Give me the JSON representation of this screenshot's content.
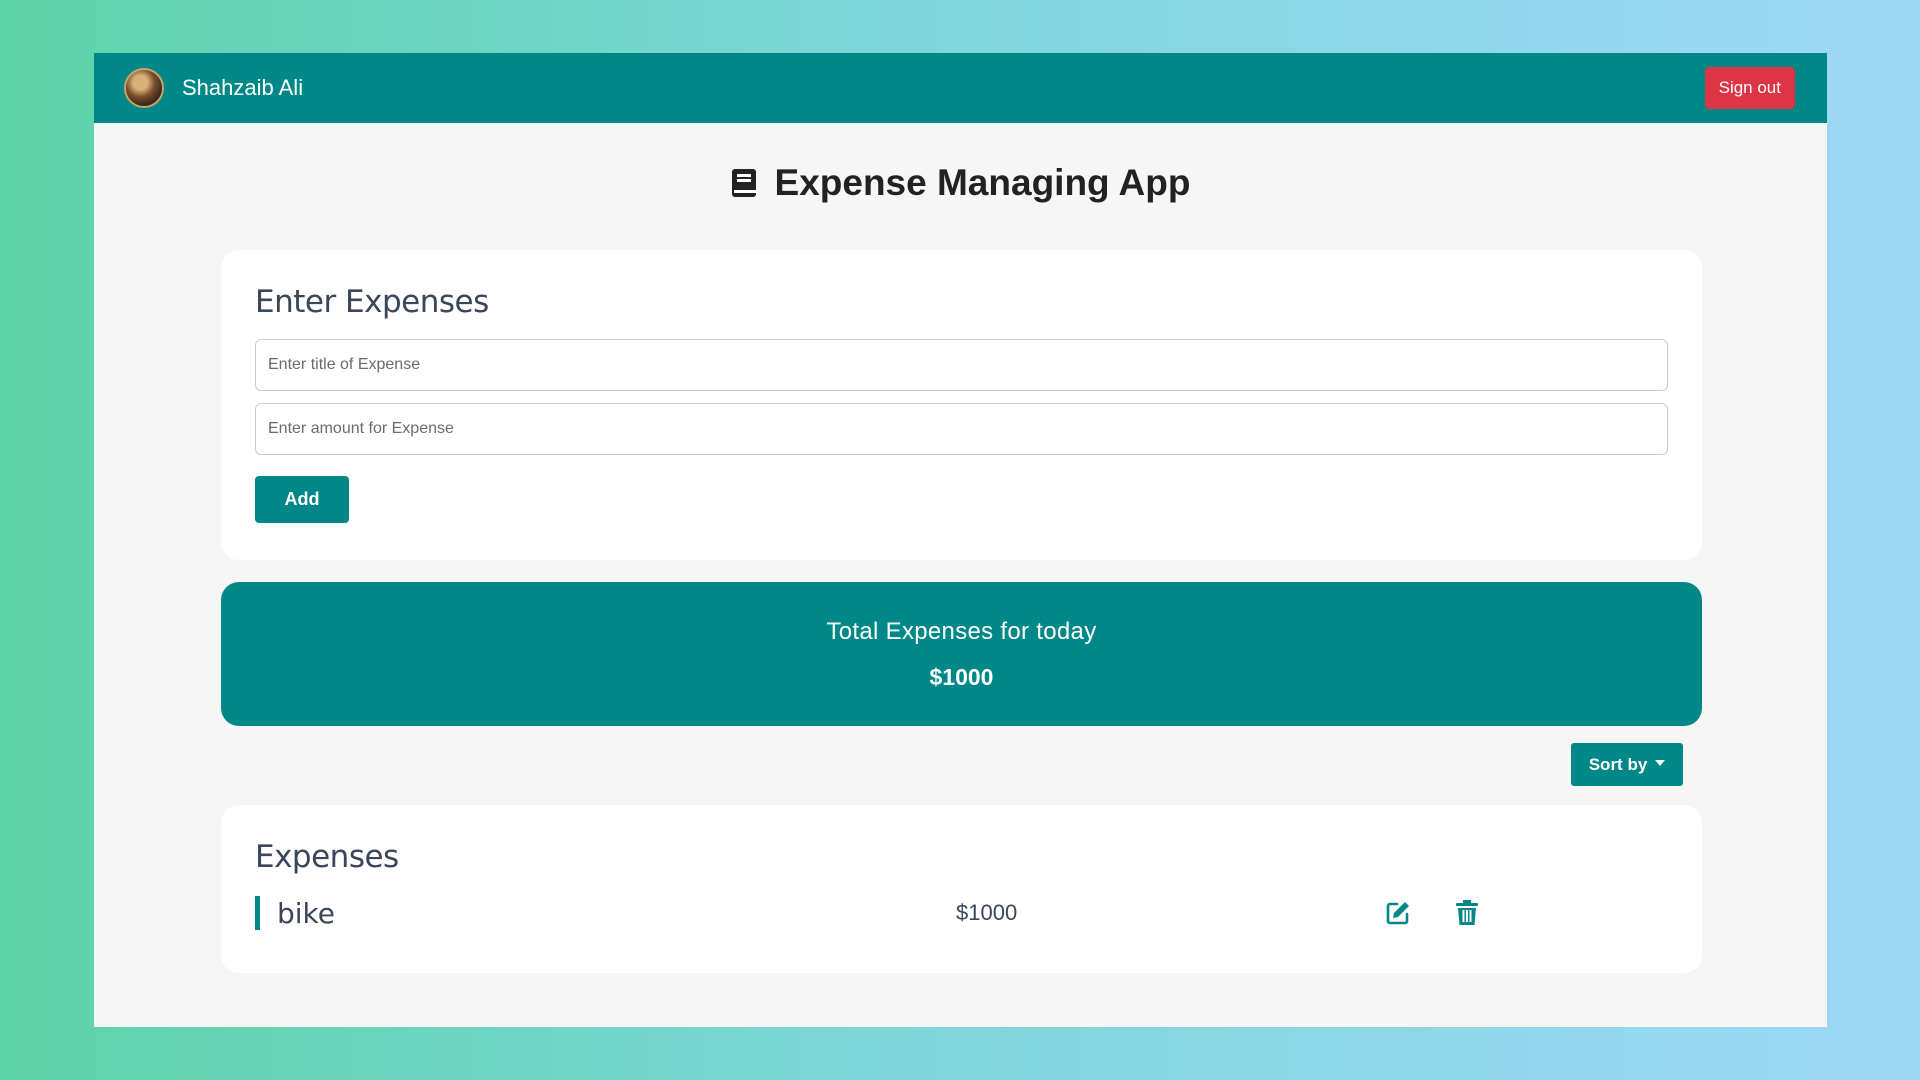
{
  "navbar": {
    "user_name": "Shahzaib Ali",
    "signout_label": "Sign out"
  },
  "header": {
    "title": "Expense Managing App",
    "icon": "book-icon"
  },
  "enter_expenses": {
    "heading": "Enter Expenses",
    "title_placeholder": "Enter title of Expense",
    "amount_placeholder": "Enter amount for Expense",
    "title_value": "",
    "amount_value": "",
    "add_label": "Add"
  },
  "total": {
    "label": "Total Expenses for today",
    "value": "$1000"
  },
  "sort": {
    "label": "Sort by"
  },
  "expenses": {
    "heading": "Expenses",
    "items": [
      {
        "title": "bike",
        "amount": "$1000",
        "edit_icon": "edit-icon",
        "delete_icon": "trash-icon"
      }
    ]
  },
  "colors": {
    "primary": "#008787",
    "danger": "#dc3545",
    "background_card": "#ffffff",
    "page_bg": "#f6f6f6"
  }
}
